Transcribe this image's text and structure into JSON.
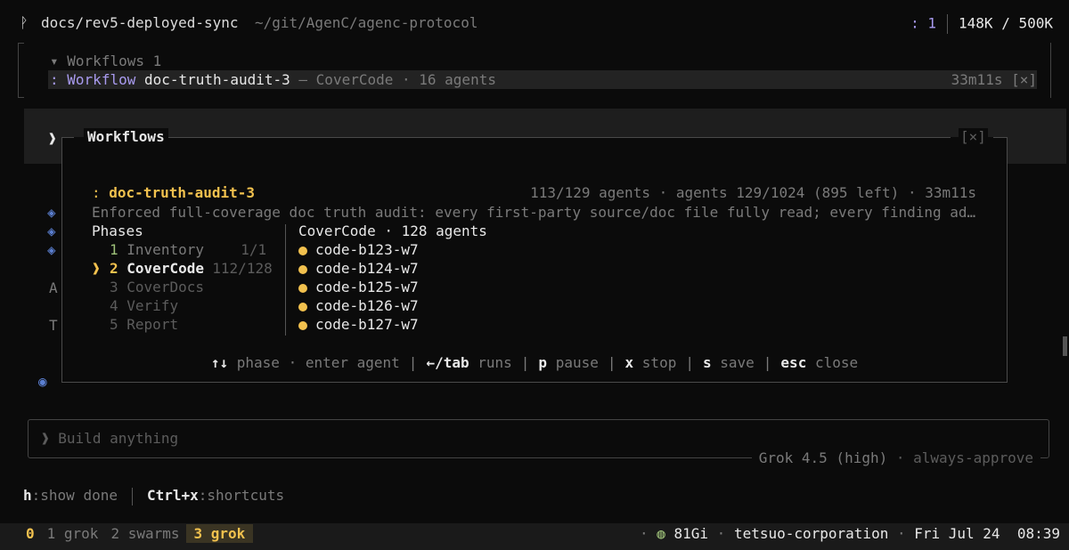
{
  "header": {
    "branch_icon": "ᚹ",
    "branch": "docs/rev5-deployed-sync",
    "path": "~/git/AgenC/agenc-protocol",
    "session_marker": ": 1",
    "tokens": "148K / 500K"
  },
  "tray": {
    "toggle_icon": "▾",
    "title": "Workflows",
    "count": "1",
    "row_prefix": ":",
    "row_kind": "Workflow",
    "row_name": "doc-truth-audit-3",
    "row_dash": "—",
    "row_detail": "CoverCode · 16 agents",
    "row_elapsed": "33m11s",
    "row_close": "[×]"
  },
  "backdrop": {
    "chevron": "❱"
  },
  "side_glyphs": [
    "◈",
    "◈",
    "◈",
    "A",
    "T",
    "◉"
  ],
  "modal": {
    "title": "Workflows",
    "close": "[×]",
    "workflow": {
      "prefix": ":",
      "name": "doc-truth-audit-3",
      "stats": "113/129 agents · agents 129/1024 (895 left) · 33m11s",
      "description": "Enforced full-coverage doc truth audit: every first-party source/doc file fully read; every finding ad…"
    },
    "phases_title": "Phases",
    "phases": [
      {
        "marker": "",
        "num": "1",
        "name": "Inventory",
        "progress": "1/1",
        "state": "done"
      },
      {
        "marker": "❱",
        "num": "2",
        "name": "CoverCode",
        "progress": "112/128",
        "state": "active"
      },
      {
        "marker": "",
        "num": "3",
        "name": "CoverDocs",
        "progress": "",
        "state": "pending"
      },
      {
        "marker": "",
        "num": "4",
        "name": "Verify",
        "progress": "",
        "state": "pending"
      },
      {
        "marker": "",
        "num": "5",
        "name": "Report",
        "progress": "",
        "state": "pending"
      }
    ],
    "agents_title": "CoverCode · 128 agents",
    "agents": [
      "code-b123-w7",
      "code-b124-w7",
      "code-b125-w7",
      "code-b126-w7",
      "code-b127-w7"
    ],
    "hints": [
      {
        "key": "↑↓",
        "label": "phase · enter agent"
      },
      {
        "key": "←/tab",
        "label": "runs"
      },
      {
        "key": "p",
        "label": "pause"
      },
      {
        "key": "x",
        "label": "stop"
      },
      {
        "key": "s",
        "label": "save"
      },
      {
        "key": "esc",
        "label": "close"
      }
    ]
  },
  "input": {
    "prompt": "❱",
    "placeholder": "Build anything",
    "model": "Grok 4.5 (high)",
    "mode": "always-approve"
  },
  "hintbar": {
    "show_done_key": "h",
    "show_done_label": ":show done",
    "shortcuts_key": "Ctrl+x",
    "shortcuts_label": ":shortcuts"
  },
  "statusbar": {
    "tabs": [
      "0",
      "1 grok",
      "2 swarms",
      "3 grok"
    ],
    "active_tab": 3,
    "mem_icon": "◍",
    "mem": "81Gi",
    "host": "tetsuo-corporation",
    "date": "Fri Jul 24",
    "time": "08:39"
  },
  "colors": {
    "background": "#0b0b0b",
    "accent_gold": "#f2c14e",
    "accent_purple": "#a99bf0",
    "accent_blue": "#5b7fd0",
    "done_green": "#9fc27a"
  }
}
